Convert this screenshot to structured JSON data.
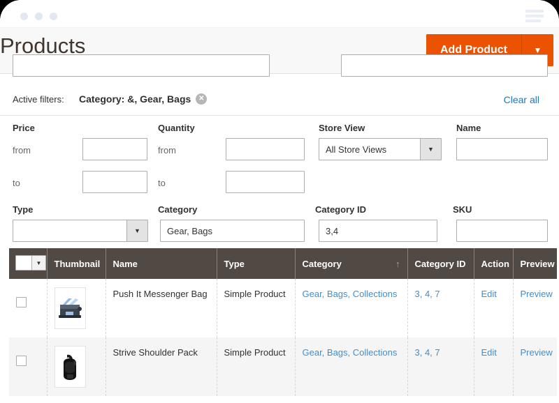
{
  "window": {
    "dots_count": 3,
    "menu_icon": "hamburger-icon"
  },
  "header": {
    "title": "Products",
    "add_product_label": "Add Product",
    "add_product_toggle_icon": "▼",
    "accent_color": "#eb5202"
  },
  "active_filters": {
    "label": "Active filters:",
    "chip_text": "Category: &, Gear, Bags",
    "chip_remove_icon": "✕",
    "clear_all_label": "Clear all",
    "link_color": "#1979c3"
  },
  "filters": {
    "price": {
      "label": "Price",
      "from_label": "from",
      "to_label": "to",
      "from_value": "",
      "to_value": ""
    },
    "quantity": {
      "label": "Quantity",
      "from_label": "from",
      "to_label": "to",
      "from_value": "",
      "to_value": ""
    },
    "store_view": {
      "label": "Store View",
      "selected": "All Store Views",
      "arrow_icon": "▼"
    },
    "name": {
      "label": "Name",
      "value": ""
    },
    "type": {
      "label": "Type",
      "selected": "",
      "arrow_icon": "▼"
    },
    "category": {
      "label": "Category",
      "value": "Gear, Bags"
    },
    "category_id": {
      "label": "Category ID",
      "value": "3,4"
    },
    "sku": {
      "label": "SKU",
      "value": ""
    }
  },
  "table": {
    "select_all_arrow_icon": "▼",
    "sort_arrow_icon": "↑",
    "sorted_column": "Category",
    "columns": [
      "Thumbnail",
      "Name",
      "Type",
      "Category",
      "Category ID",
      "Action",
      "Preview"
    ],
    "rows": [
      {
        "thumbnail": "messenger-bag-thumbnail",
        "name": "Push It Messenger Bag",
        "type": "Simple Product",
        "category": "Gear, Bags, Collections",
        "category_id": "3, 4, 7",
        "action": "Edit",
        "preview": "Preview"
      },
      {
        "thumbnail": "shoulder-pack-thumbnail",
        "name": "Strive Shoulder Pack",
        "type": "Simple Product",
        "category": "Gear, Bags, Collections",
        "category_id": "3, 4, 7",
        "action": "Edit",
        "preview": "Preview"
      }
    ]
  }
}
